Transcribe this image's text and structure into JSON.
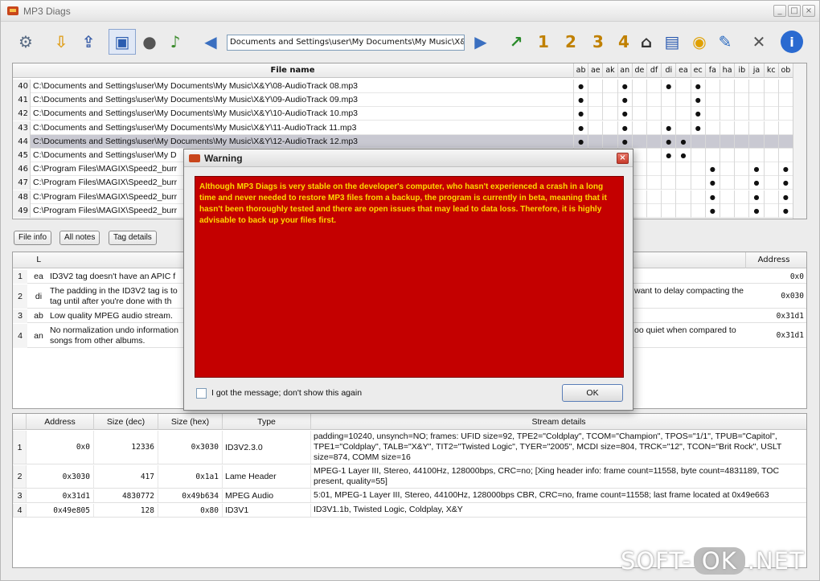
{
  "window": {
    "title": "MP3 Diags"
  },
  "toolbar": {
    "path": "Documents and Settings\\user\\My Documents\\My Music\\X&Y",
    "icons": [
      "gear-icon",
      "scan-icon",
      "folder-scan-icon",
      "session-icon",
      "cd-icon",
      "note-icon",
      "back-arrow-icon",
      "forward-arrow-icon",
      "transform1-icon",
      "transform2-icon",
      "transform3-icon",
      "transform4-icon",
      "tag-icon",
      "chart-icon",
      "normalize-icon",
      "edit-icon",
      "tools-icon",
      "info-icon"
    ]
  },
  "files": {
    "header": {
      "name": "File name",
      "codes": [
        "ab",
        "ae",
        "ak",
        "an",
        "de",
        "df",
        "di",
        "ea",
        "ec",
        "fa",
        "ha",
        "ib",
        "ja",
        "kc",
        "ob"
      ]
    },
    "rows": [
      {
        "num": "40",
        "path": "C:\\Documents and Settings\\user\\My Documents\\My Music\\X&Y\\08-AudioTrack 08.mp3",
        "dots": [
          0,
          3,
          6,
          8
        ]
      },
      {
        "num": "41",
        "path": "C:\\Documents and Settings\\user\\My Documents\\My Music\\X&Y\\09-AudioTrack 09.mp3",
        "dots": [
          0,
          3,
          8
        ]
      },
      {
        "num": "42",
        "path": "C:\\Documents and Settings\\user\\My Documents\\My Music\\X&Y\\10-AudioTrack 10.mp3",
        "dots": [
          0,
          3,
          8
        ]
      },
      {
        "num": "43",
        "path": "C:\\Documents and Settings\\user\\My Documents\\My Music\\X&Y\\11-AudioTrack 11.mp3",
        "dots": [
          0,
          3,
          6,
          8
        ]
      },
      {
        "num": "44",
        "path": "C:\\Documents and Settings\\user\\My Documents\\My Music\\X&Y\\12-AudioTrack 12.mp3",
        "dots": [
          0,
          3,
          6,
          7
        ],
        "selected": true
      },
      {
        "num": "45",
        "path": "C:\\Documents and Settings\\user\\My D",
        "dots": [
          6,
          7
        ]
      },
      {
        "num": "46",
        "path": "C:\\Program Files\\MAGIX\\Speed2_burr",
        "dots": [
          9,
          12,
          14
        ]
      },
      {
        "num": "47",
        "path": "C:\\Program Files\\MAGIX\\Speed2_burr",
        "dots": [
          9,
          12,
          14
        ]
      },
      {
        "num": "48",
        "path": "C:\\Program Files\\MAGIX\\Speed2_burr",
        "dots": [
          9,
          12,
          14
        ]
      },
      {
        "num": "49",
        "path": "C:\\Program Files\\MAGIX\\Speed2_burr",
        "dots": [
          9,
          12,
          14
        ]
      }
    ]
  },
  "tabs": [
    "File info",
    "All notes",
    "Tag details"
  ],
  "notes": {
    "header": {
      "level": "L",
      "address": "Address"
    },
    "rows": [
      {
        "num": "1",
        "level": "ea",
        "text": "ID3V2 tag doesn't have an APIC f",
        "address": "0x0"
      },
      {
        "num": "2",
        "level": "di",
        "text": "The padding in the ID3V2 tag is to",
        "text2": "tag until after you're done with th",
        "right": "want to delay compacting the",
        "address": "0x030"
      },
      {
        "num": "3",
        "level": "ab",
        "text": "Low quality MPEG audio stream.",
        "address": "0x31d1"
      },
      {
        "num": "4",
        "level": "an",
        "text": "No normalization undo information",
        "text2": "songs from other albums.",
        "right": "oo quiet when compared to",
        "address": "0x31d1"
      }
    ]
  },
  "streams": {
    "header": {
      "address": "Address",
      "size_dec": "Size (dec)",
      "size_hex": "Size (hex)",
      "type": "Type",
      "details": "Stream details"
    },
    "rows": [
      {
        "num": "1",
        "address": "0x0",
        "size_dec": "12336",
        "size_hex": "0x3030",
        "type": "ID3V2.3.0",
        "details": "padding=10240, unsynch=NO; frames: UFID size=92, TPE2=\"Coldplay\", TCOM=\"Champion\", TPOS=\"1/1\", TPUB=\"Capitol\", TPE1=\"Coldplay\", TALB=\"X&Y\", TIT2=\"Twisted Logic\", TYER=\"2005\", MCDI size=804, TRCK=\"12\", TCON=\"Brit Rock\", USLT size=874, COMM size=16"
      },
      {
        "num": "2",
        "address": "0x3030",
        "size_dec": "417",
        "size_hex": "0x1a1",
        "type": "Lame Header",
        "details": "MPEG-1 Layer III, Stereo, 44100Hz, 128000bps, CRC=no; [Xing header info: frame count=11558, byte count=4831189, TOC present, quality=55]"
      },
      {
        "num": "3",
        "address": "0x31d1",
        "size_dec": "4830772",
        "size_hex": "0x49b634",
        "type": "MPEG Audio",
        "details": "5:01, MPEG-1 Layer III, Stereo, 44100Hz, 128000bps CBR, CRC=no, frame count=11558; last frame located at 0x49e663"
      },
      {
        "num": "4",
        "address": "0x49e805",
        "size_dec": "128",
        "size_hex": "0x80",
        "type": "ID3V1",
        "details": "ID3V1.1b, Twisted Logic, Coldplay, X&Y"
      }
    ]
  },
  "dialog": {
    "title": "Warning",
    "message": "Although MP3 Diags is very stable on the developer's computer, who hasn't experienced a crash in a long time and never needed to restore MP3 files from a backup, the program is currently in beta, meaning that it hasn't been thoroughly tested and there are open issues that may lead to data loss. Therefore, it is highly advisable to back up your files first.",
    "checkbox_label": "I got the message; don't show this again",
    "ok_label": "OK"
  },
  "watermark": {
    "left": "SOFT-",
    "mid": "OK",
    "right": ".NET"
  }
}
